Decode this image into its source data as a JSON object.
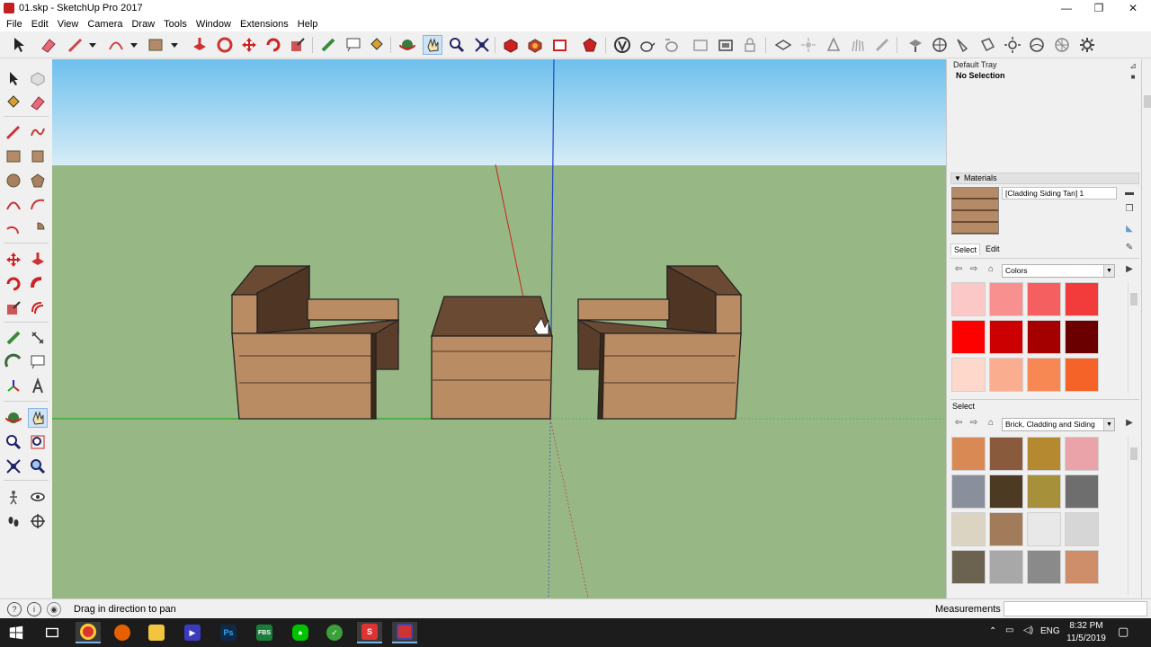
{
  "window": {
    "title": "01.skp - SketchUp Pro 2017",
    "controls": {
      "minimize": "—",
      "maximize": "❐",
      "close": "✕"
    }
  },
  "menu": [
    "File",
    "Edit",
    "View",
    "Camera",
    "Draw",
    "Tools",
    "Window",
    "Extensions",
    "Help"
  ],
  "tray": {
    "header": "Default Tray",
    "selection_status": "No Selection",
    "materials_panel": {
      "title": "Materials",
      "material_name": "[Cladding Siding Tan] 1",
      "tabs": {
        "select": "Select",
        "edit": "Edit"
      },
      "top_library": "Colors",
      "color_swatches": [
        "#fcc7c7",
        "#f99090",
        "#f55f5f",
        "#f23b3b",
        "#fd0000",
        "#cd0000",
        "#a50000",
        "#6a0000",
        "#fdd8cb",
        "#faae8f",
        "#f88853",
        "#f66329"
      ],
      "select_label": "Select",
      "bottom_library": "Brick, Cladding and Siding",
      "texture_swatches": [
        "#d98954",
        "#8a5a3c",
        "#b4892f",
        "#eaa3a8",
        "#8a8f9c",
        "#4d3a22",
        "#a6903a",
        "#6e6e6e",
        "#dcd4c2",
        "#a27b5b",
        "#e8e8e8",
        "#d6d6d6",
        "#6b6250",
        "#a8a8a8",
        "#8a8a8a",
        "#cf8e6a"
      ]
    }
  },
  "status": {
    "hint": "Drag in direction to pan",
    "measurements_label": "Measurements",
    "measurements_value": ""
  },
  "taskbar": {
    "apps": [
      "windows-start",
      "task-view",
      "chrome",
      "firefox",
      "file-explorer",
      "visual-studio",
      "photoshop",
      "fbs",
      "line",
      "green-app",
      "sketchup",
      "sketchup-2"
    ],
    "language": "ENG",
    "time": "8:32 PM",
    "date": "11/5/2019"
  },
  "scene": {
    "sky_color": "#9dd4ee",
    "ground_color": "#97b884",
    "wood_light": "#b98c64",
    "wood_dark": "#6b4a33"
  }
}
